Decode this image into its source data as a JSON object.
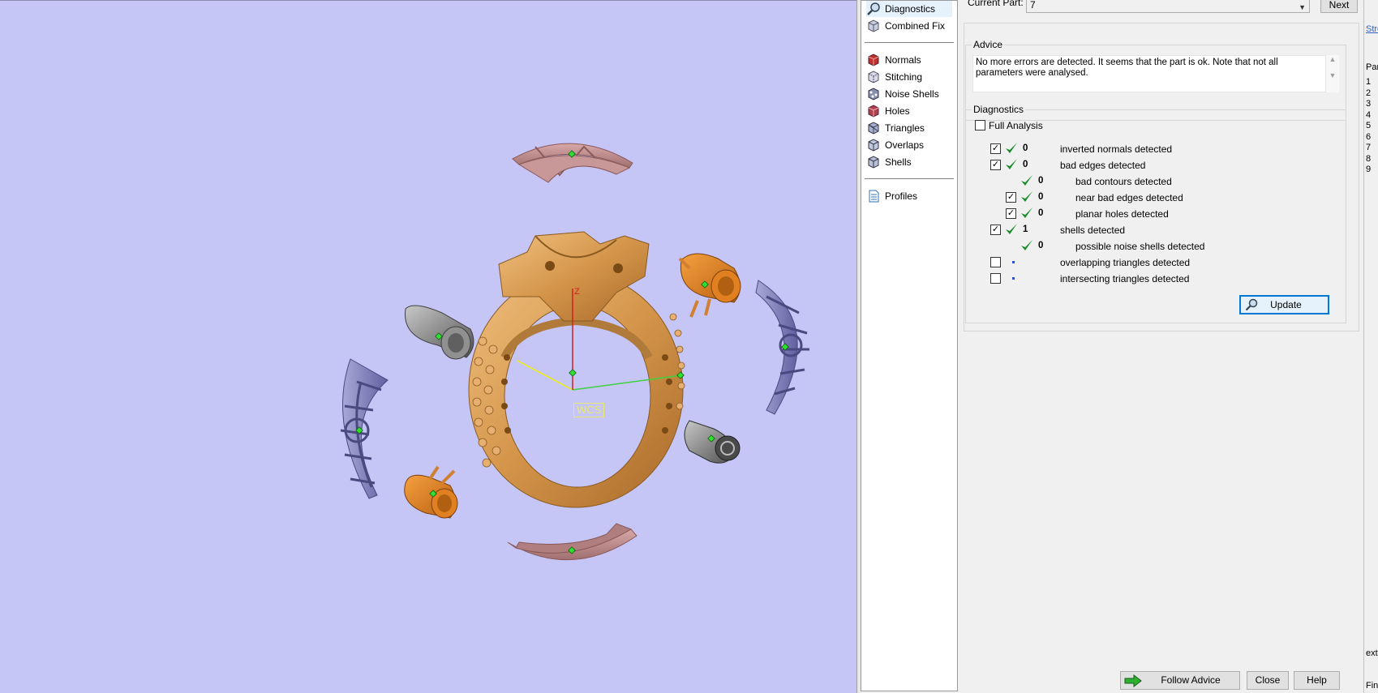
{
  "viewport": {
    "wcs_label": "WCS",
    "axis_z_label": "Z"
  },
  "tools": {
    "top": [
      {
        "label": "Diagnostics",
        "icon": "magnifier-icon",
        "selected": true
      },
      {
        "label": "Combined Fix",
        "icon": "cube-fix-icon"
      }
    ],
    "middle": [
      {
        "label": "Normals",
        "icon": "normals-cube-icon"
      },
      {
        "label": "Stitching",
        "icon": "stitching-cube-icon"
      },
      {
        "label": "Noise Shells",
        "icon": "noise-shells-cube-icon"
      },
      {
        "label": "Holes",
        "icon": "holes-cube-icon"
      },
      {
        "label": "Triangles",
        "icon": "triangles-cube-icon"
      },
      {
        "label": "Overlaps",
        "icon": "overlaps-cube-icon"
      },
      {
        "label": "Shells",
        "icon": "shells-cube-icon"
      }
    ],
    "bottom": [
      {
        "label": "Profiles",
        "icon": "profiles-doc-icon"
      }
    ]
  },
  "current_part": {
    "label": "Current Part:",
    "value": "7",
    "next_label": "Next"
  },
  "advice": {
    "title": "Advice",
    "text": "No more errors are detected. It seems that the part is ok. Note that not all parameters were analysed."
  },
  "diagnostics": {
    "title": "Diagnostics",
    "full_analysis_label": "Full Analysis",
    "full_analysis_checked": false,
    "rows": [
      {
        "checkbox": true,
        "checked": true,
        "status": "ok",
        "count": "0",
        "label": "inverted normals detected",
        "indent": 0
      },
      {
        "checkbox": true,
        "checked": true,
        "status": "ok",
        "count": "0",
        "label": "bad edges detected",
        "indent": 0
      },
      {
        "checkbox": false,
        "checked": false,
        "status": "ok",
        "count": "0",
        "label": "bad contours detected",
        "indent": 1
      },
      {
        "checkbox": true,
        "checked": true,
        "status": "ok",
        "count": "0",
        "label": "near bad edges detected",
        "indent": 1
      },
      {
        "checkbox": true,
        "checked": true,
        "status": "ok",
        "count": "0",
        "label": "planar holes detected",
        "indent": 1
      },
      {
        "checkbox": true,
        "checked": true,
        "status": "ok",
        "count": "1",
        "label": "shells detected",
        "indent": 0
      },
      {
        "checkbox": false,
        "checked": false,
        "status": "ok",
        "count": "0",
        "label": "possible noise shells detected",
        "indent": 1
      },
      {
        "checkbox": true,
        "checked": false,
        "status": "none",
        "count": "",
        "label": "overlapping triangles detected",
        "indent": 0
      },
      {
        "checkbox": true,
        "checked": false,
        "status": "none",
        "count": "",
        "label": "intersecting triangles detected",
        "indent": 0
      }
    ],
    "update_label": "Update"
  },
  "footer": {
    "follow_advice_label": "Follow Advice",
    "close_label": "Close",
    "help_label": "Help"
  },
  "right_panel": {
    "top_link": "Stre",
    "header": "Par",
    "rows": [
      "1",
      "2",
      "3",
      "4",
      "5",
      "6",
      "7",
      "8",
      "9"
    ],
    "bottom_text": "extu",
    "bottom_text2": "Fin"
  },
  "colors": {
    "viewport_bg": "#c5c5f6",
    "gold": "#d4954a",
    "blue_part": "#8080c0",
    "pink_part": "#c09090",
    "check_green": "#1a8c2a"
  }
}
